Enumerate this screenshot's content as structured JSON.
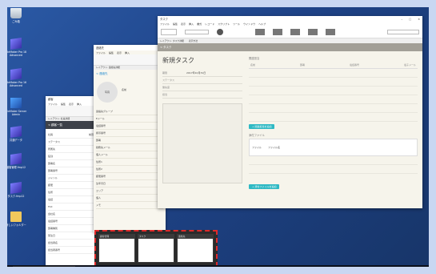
{
  "desktop": {
    "icons": [
      {
        "label": "ごみ箱",
        "glyph": "recycle-bin"
      },
      {
        "label": "FileMaker Pro 18 Advanced",
        "glyph": "app"
      },
      {
        "label": "FileMaker Pro 16 Advanced",
        "glyph": "app"
      },
      {
        "label": "FileMaker Server Admin",
        "glyph": "app2"
      },
      {
        "label": "共通データ",
        "glyph": "app"
      },
      {
        "label": "顧客管理.fmp12",
        "glyph": "app"
      },
      {
        "label": "タスク.fmp12",
        "glyph": "app"
      },
      {
        "label": "新しいフォルダー",
        "glyph": "folder"
      }
    ]
  },
  "windows": {
    "back": {
      "title": "顧客",
      "menu": [
        "ファイル",
        "編集",
        "表示",
        "挿入",
        "書式",
        "レコード"
      ],
      "layout_label": "レイアウト: 社員詳細",
      "back_link": "< 顧客一覧",
      "fields": [
        {
          "label": "社員",
          "value": "前田 静香"
        },
        {
          "label": "ステータス",
          "value": ""
        },
        {
          "label": "所属先",
          "value": ""
        },
        {
          "label": "役割",
          "value": ""
        },
        {
          "label": "部署名",
          "value": ""
        },
        {
          "label": "部署番号",
          "value": ""
        },
        {
          "label": "ジャンル",
          "value": ""
        },
        {
          "label": "郵便",
          "value": ""
        },
        {
          "label": "住所",
          "value": ""
        },
        {
          "label": "電話",
          "value": ""
        },
        {
          "label": "FAX",
          "value": ""
        },
        {
          "label": "会社名",
          "value": ""
        },
        {
          "label": "電話番号",
          "value": ""
        },
        {
          "label": "部署種別",
          "value": ""
        },
        {
          "label": "受注日",
          "value": ""
        },
        {
          "label": "担当者名",
          "value": ""
        },
        {
          "label": "担当者番号",
          "value": ""
        }
      ]
    },
    "middle": {
      "title": "連絡先",
      "menu": [
        "ファイル",
        "編集",
        "表示",
        "挿入",
        "書式",
        "レコード"
      ],
      "layout_label": "レイアウト: 連絡先詳細",
      "back_link": "< 連絡先",
      "avatar": "写真",
      "name_label": "名前",
      "name_value": "",
      "side_labels": [
        "連絡先グループ",
        "Eメール",
        "電話番号",
        "携帯番号",
        "部署",
        "勤務先メール",
        "個人メール",
        "住所1",
        "住所2",
        "郵便番号",
        "生年月日",
        "エリア",
        "個人",
        "メモ"
      ]
    },
    "front": {
      "title": "タスク",
      "menu": [
        "ファイル",
        "編集",
        "表示",
        "挿入",
        "書式",
        "レコード",
        "スクリプト",
        "ツール",
        "ウインドウ",
        "ヘルプ"
      ],
      "layout_label": "レイアウト: タスク詳細",
      "view_label": "表示方法",
      "back_link": "< タスク",
      "task_title": "新規タスク",
      "fields": [
        {
          "label": "期限",
          "value": "2017年10月31日"
        },
        {
          "label": "ステータス",
          "value": ""
        },
        {
          "label": "優先度",
          "value": ""
        },
        {
          "label": "担当",
          "value": ""
        }
      ],
      "right_head": "関連担当",
      "cols": [
        "名前",
        "部署",
        "電話番号",
        "電子メール"
      ],
      "add_related": "+ 関連担当を追加",
      "attach_head": "添付ファイル",
      "attach_row": [
        "ファイル",
        "ファイル名"
      ],
      "add_attach": "+ 添付ファイルを追加",
      "win_controls": [
        "–",
        "□",
        "×"
      ]
    }
  },
  "taskbar": {
    "search": "ここに入力して検索",
    "time": "11:07",
    "date": "2019/10/30",
    "ime": "A"
  },
  "thumbs": [
    "顧客管理",
    "タスク",
    "連絡先"
  ]
}
